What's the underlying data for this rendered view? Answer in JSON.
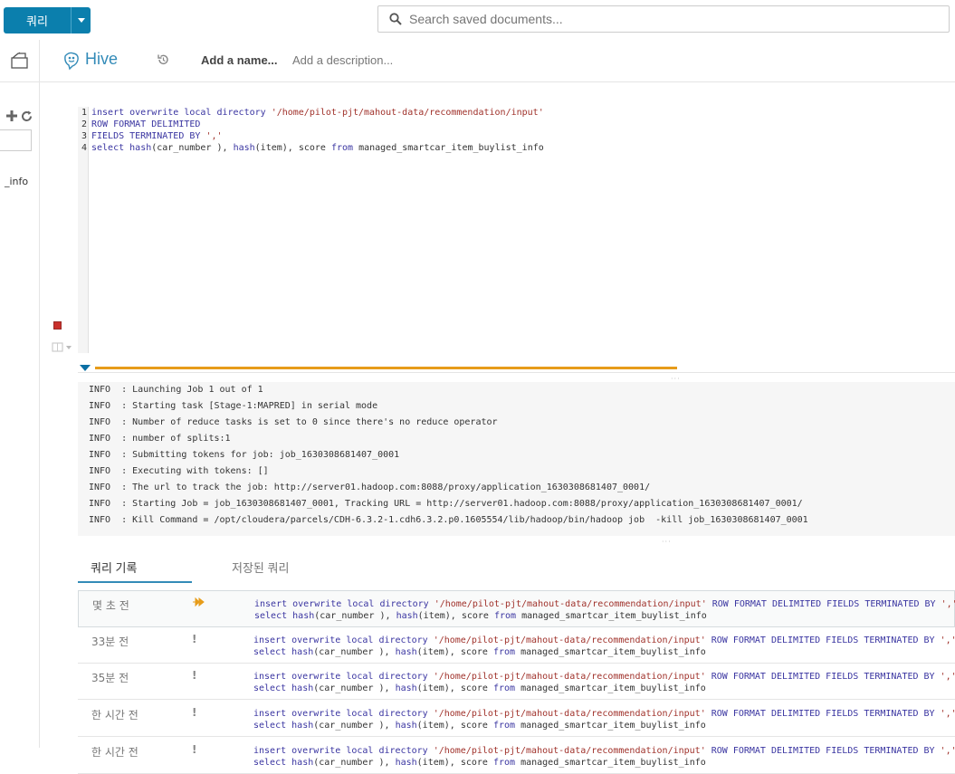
{
  "toolbar": {
    "query_button_label": "쿼리"
  },
  "search": {
    "placeholder": "Search saved documents..."
  },
  "left_panel": {
    "table_item": "_info"
  },
  "editor_header": {
    "type_title": "Hive",
    "name_placeholder": "Add a name...",
    "description_placeholder": "Add a description..."
  },
  "editor": {
    "line_numbers": [
      "1",
      "2",
      "3",
      "4"
    ],
    "lines": [
      [
        {
          "t": "kw",
          "v": "insert overwrite local directory "
        },
        {
          "t": "str",
          "v": "'/home/pilot-pjt/mahout-data/recommendation/input'"
        }
      ],
      [
        {
          "t": "kw",
          "v": "ROW FORMAT DELIMITED"
        }
      ],
      [
        {
          "t": "kw",
          "v": "FIELDS TERMINATED BY "
        },
        {
          "t": "str",
          "v": "','"
        }
      ],
      [
        {
          "t": "kw",
          "v": "select "
        },
        {
          "t": "fn",
          "v": "hash"
        },
        {
          "t": "pl",
          "v": "(car_number ), "
        },
        {
          "t": "fn",
          "v": "hash"
        },
        {
          "t": "pl",
          "v": "(item), score "
        },
        {
          "t": "kw",
          "v": "from"
        },
        {
          "t": "pl",
          "v": " managed_smartcar_item_buylist_info"
        }
      ]
    ],
    "colors": {
      "keyword": "#3a35a1",
      "string": "#a0322b",
      "progress": "#e79c1a"
    }
  },
  "logs": [
    "INFO  : Launching Job 1 out of 1",
    "INFO  : Starting task [Stage-1:MAPRED] in serial mode",
    "INFO  : Number of reduce tasks is set to 0 since there's no reduce operator",
    "INFO  : number of splits:1",
    "INFO  : Submitting tokens for job: job_1630308681407_0001",
    "INFO  : Executing with tokens: []",
    "INFO  : The url to track the job: http://server01.hadoop.com:8088/proxy/application_1630308681407_0001/",
    "INFO  : Starting Job = job_1630308681407_0001, Tracking URL = http://server01.hadoop.com:8088/proxy/application_1630308681407_0001/",
    "INFO  : Kill Command = /opt/cloudera/parcels/CDH-6.3.2-1.cdh6.3.2.p0.1605554/lib/hadoop/bin/hadoop job  -kill job_1630308681407_0001"
  ],
  "tabs": {
    "history": "쿼리 기록",
    "saved": "저장된 쿼리"
  },
  "history": [
    {
      "time": "몇 초 전",
      "status": "running",
      "status_icon": "running-icon"
    },
    {
      "time": "33분 전",
      "status": "!",
      "status_icon": "error-icon"
    },
    {
      "time": "35분 전",
      "status": "!",
      "status_icon": "error-icon"
    },
    {
      "time": "한 시간 전",
      "status": "!",
      "status_icon": "error-icon"
    },
    {
      "time": "한 시간 전",
      "status": "!",
      "status_icon": "error-icon"
    }
  ],
  "history_query": {
    "line1": [
      {
        "t": "kw",
        "v": "insert overwrite local directory "
      },
      {
        "t": "str",
        "v": "'/home/pilot-pjt/mahout-data/recommendation/input'"
      },
      {
        "t": "kw",
        "v": " ROW FORMAT DELIMITED FIELDS TERMINATED BY "
      },
      {
        "t": "str",
        "v": "','"
      }
    ],
    "line2": [
      {
        "t": "kw",
        "v": "select "
      },
      {
        "t": "fn",
        "v": "hash"
      },
      {
        "t": "pl",
        "v": "(car_number ), "
      },
      {
        "t": "fn",
        "v": "hash"
      },
      {
        "t": "pl",
        "v": "(item), score "
      },
      {
        "t": "kw",
        "v": "from"
      },
      {
        "t": "pl",
        "v": " managed_smartcar_item_buylist_info"
      }
    ]
  }
}
